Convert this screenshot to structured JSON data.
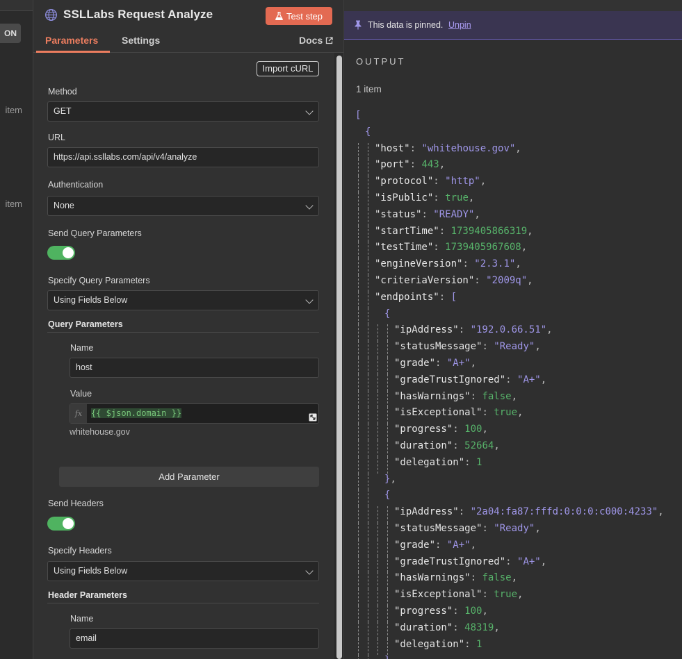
{
  "backdrop": {
    "top_button_label": "ON",
    "item_labels": [
      "item",
      "item"
    ]
  },
  "node": {
    "title": "SSLLabs Request Analyze",
    "test_button": "Test step",
    "tabs": {
      "parameters": "Parameters",
      "settings": "Settings",
      "docs": "Docs"
    }
  },
  "params": {
    "import_curl": "Import cURL",
    "method": {
      "label": "Method",
      "value": "GET"
    },
    "url": {
      "label": "URL",
      "value": "https://api.ssllabs.com/api/v4/analyze"
    },
    "authentication": {
      "label": "Authentication",
      "value": "None"
    },
    "send_query": {
      "label": "Send Query Parameters",
      "on": true
    },
    "specify_query": {
      "label": "Specify Query Parameters",
      "value": "Using Fields Below"
    },
    "query_params_heading": "Query Parameters",
    "query_name": {
      "label": "Name",
      "value": "host"
    },
    "query_value": {
      "label": "Value",
      "fx": "fx",
      "expression": "{{ $json.domain }}",
      "result": "whitehouse.gov"
    },
    "add_parameter": "Add Parameter",
    "send_headers": {
      "label": "Send Headers",
      "on": true
    },
    "specify_headers": {
      "label": "Specify Headers",
      "value": "Using Fields Below"
    },
    "header_params_heading": "Header Parameters",
    "header_name": {
      "label": "Name",
      "value": "email"
    }
  },
  "output": {
    "pin_message": "This data is pinned.",
    "unpin": "Unpin",
    "title": "OUTPUT",
    "item_count": "1 item",
    "json_lines": [
      {
        "d": 0,
        "t": [
          [
            "br",
            "["
          ]
        ]
      },
      {
        "d": 1,
        "t": [
          [
            "br",
            "{"
          ]
        ]
      },
      {
        "d": 2,
        "t": [
          [
            "k",
            "\"host\""
          ],
          [
            "p",
            ": "
          ],
          [
            "s",
            "\"whitehouse.gov\""
          ],
          [
            "p",
            ","
          ]
        ]
      },
      {
        "d": 2,
        "t": [
          [
            "k",
            "\"port\""
          ],
          [
            "p",
            ": "
          ],
          [
            "n",
            "443"
          ],
          [
            "p",
            ","
          ]
        ]
      },
      {
        "d": 2,
        "t": [
          [
            "k",
            "\"protocol\""
          ],
          [
            "p",
            ": "
          ],
          [
            "s",
            "\"http\""
          ],
          [
            "p",
            ","
          ]
        ]
      },
      {
        "d": 2,
        "t": [
          [
            "k",
            "\"isPublic\""
          ],
          [
            "p",
            ": "
          ],
          [
            "b",
            "true"
          ],
          [
            "p",
            ","
          ]
        ]
      },
      {
        "d": 2,
        "t": [
          [
            "k",
            "\"status\""
          ],
          [
            "p",
            ": "
          ],
          [
            "s",
            "\"READY\""
          ],
          [
            "p",
            ","
          ]
        ]
      },
      {
        "d": 2,
        "t": [
          [
            "k",
            "\"startTime\""
          ],
          [
            "p",
            ": "
          ],
          [
            "n",
            "1739405866319"
          ],
          [
            "p",
            ","
          ]
        ]
      },
      {
        "d": 2,
        "t": [
          [
            "k",
            "\"testTime\""
          ],
          [
            "p",
            ": "
          ],
          [
            "n",
            "1739405967608"
          ],
          [
            "p",
            ","
          ]
        ]
      },
      {
        "d": 2,
        "t": [
          [
            "k",
            "\"engineVersion\""
          ],
          [
            "p",
            ": "
          ],
          [
            "s",
            "\"2.3.1\""
          ],
          [
            "p",
            ","
          ]
        ]
      },
      {
        "d": 2,
        "t": [
          [
            "k",
            "\"criteriaVersion\""
          ],
          [
            "p",
            ": "
          ],
          [
            "s",
            "\"2009q\""
          ],
          [
            "p",
            ","
          ]
        ]
      },
      {
        "d": 2,
        "t": [
          [
            "k",
            "\"endpoints\""
          ],
          [
            "p",
            ": "
          ],
          [
            "br",
            "["
          ]
        ]
      },
      {
        "d": 3,
        "t": [
          [
            "br",
            "{"
          ]
        ]
      },
      {
        "d": 4,
        "t": [
          [
            "k",
            "\"ipAddress\""
          ],
          [
            "p",
            ": "
          ],
          [
            "s",
            "\"192.0.66.51\""
          ],
          [
            "p",
            ","
          ]
        ]
      },
      {
        "d": 4,
        "t": [
          [
            "k",
            "\"statusMessage\""
          ],
          [
            "p",
            ": "
          ],
          [
            "s",
            "\"Ready\""
          ],
          [
            "p",
            ","
          ]
        ]
      },
      {
        "d": 4,
        "t": [
          [
            "k",
            "\"grade\""
          ],
          [
            "p",
            ": "
          ],
          [
            "s",
            "\"A+\""
          ],
          [
            "p",
            ","
          ]
        ]
      },
      {
        "d": 4,
        "t": [
          [
            "k",
            "\"gradeTrustIgnored\""
          ],
          [
            "p",
            ": "
          ],
          [
            "s",
            "\"A+\""
          ],
          [
            "p",
            ","
          ]
        ]
      },
      {
        "d": 4,
        "t": [
          [
            "k",
            "\"hasWarnings\""
          ],
          [
            "p",
            ": "
          ],
          [
            "b",
            "false"
          ],
          [
            "p",
            ","
          ]
        ]
      },
      {
        "d": 4,
        "t": [
          [
            "k",
            "\"isExceptional\""
          ],
          [
            "p",
            ": "
          ],
          [
            "b",
            "true"
          ],
          [
            "p",
            ","
          ]
        ]
      },
      {
        "d": 4,
        "t": [
          [
            "k",
            "\"progress\""
          ],
          [
            "p",
            ": "
          ],
          [
            "n",
            "100"
          ],
          [
            "p",
            ","
          ]
        ]
      },
      {
        "d": 4,
        "t": [
          [
            "k",
            "\"duration\""
          ],
          [
            "p",
            ": "
          ],
          [
            "n",
            "52664"
          ],
          [
            "p",
            ","
          ]
        ]
      },
      {
        "d": 4,
        "t": [
          [
            "k",
            "\"delegation\""
          ],
          [
            "p",
            ": "
          ],
          [
            "n",
            "1"
          ]
        ]
      },
      {
        "d": 3,
        "t": [
          [
            "br",
            "}"
          ],
          [
            "p",
            ","
          ]
        ]
      },
      {
        "d": 3,
        "t": [
          [
            "br",
            "{"
          ]
        ]
      },
      {
        "d": 4,
        "t": [
          [
            "k",
            "\"ipAddress\""
          ],
          [
            "p",
            ": "
          ],
          [
            "s",
            "\"2a04:fa87:fffd:0:0:0:c000:4233\""
          ],
          [
            "p",
            ","
          ]
        ]
      },
      {
        "d": 4,
        "t": [
          [
            "k",
            "\"statusMessage\""
          ],
          [
            "p",
            ": "
          ],
          [
            "s",
            "\"Ready\""
          ],
          [
            "p",
            ","
          ]
        ]
      },
      {
        "d": 4,
        "t": [
          [
            "k",
            "\"grade\""
          ],
          [
            "p",
            ": "
          ],
          [
            "s",
            "\"A+\""
          ],
          [
            "p",
            ","
          ]
        ]
      },
      {
        "d": 4,
        "t": [
          [
            "k",
            "\"gradeTrustIgnored\""
          ],
          [
            "p",
            ": "
          ],
          [
            "s",
            "\"A+\""
          ],
          [
            "p",
            ","
          ]
        ]
      },
      {
        "d": 4,
        "t": [
          [
            "k",
            "\"hasWarnings\""
          ],
          [
            "p",
            ": "
          ],
          [
            "b",
            "false"
          ],
          [
            "p",
            ","
          ]
        ]
      },
      {
        "d": 4,
        "t": [
          [
            "k",
            "\"isExceptional\""
          ],
          [
            "p",
            ": "
          ],
          [
            "b",
            "true"
          ],
          [
            "p",
            ","
          ]
        ]
      },
      {
        "d": 4,
        "t": [
          [
            "k",
            "\"progress\""
          ],
          [
            "p",
            ": "
          ],
          [
            "n",
            "100"
          ],
          [
            "p",
            ","
          ]
        ]
      },
      {
        "d": 4,
        "t": [
          [
            "k",
            "\"duration\""
          ],
          [
            "p",
            ": "
          ],
          [
            "n",
            "48319"
          ],
          [
            "p",
            ","
          ]
        ]
      },
      {
        "d": 4,
        "t": [
          [
            "k",
            "\"delegation\""
          ],
          [
            "p",
            ": "
          ],
          [
            "n",
            "1"
          ]
        ]
      },
      {
        "d": 3,
        "t": [
          [
            "br",
            "}"
          ]
        ]
      },
      {
        "d": 2,
        "t": [
          [
            "br",
            "]"
          ]
        ]
      }
    ]
  },
  "colors": {
    "accent": "#ec7d5f",
    "test_button": "#e36a52",
    "toggle_on": "#4fb360",
    "pin_bar": "#3a3551",
    "json_string": "#9f96e8",
    "json_number": "#57b36a"
  },
  "icons": {
    "node": "globe-icon",
    "test": "flask-icon",
    "docs": "external-link-icon",
    "pin": "pin-icon",
    "expand": "expand-icon",
    "dropdown": "chevron-down-icon"
  }
}
